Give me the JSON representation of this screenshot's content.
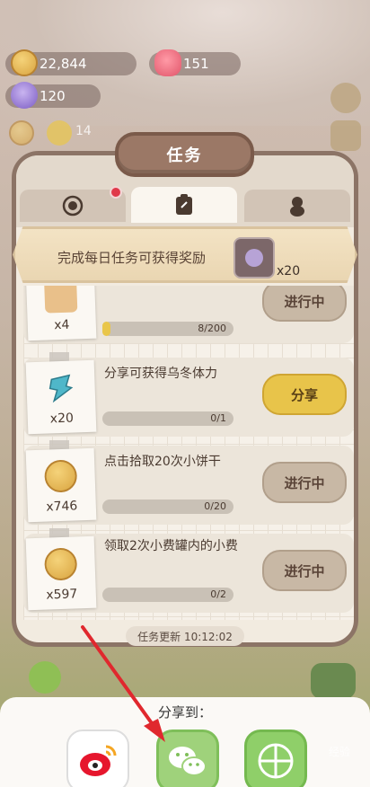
{
  "resources": [
    {
      "name": "cookie",
      "value": "22,844"
    },
    {
      "name": "pig-token",
      "value": "151"
    },
    {
      "name": "candy",
      "value": "120"
    }
  ],
  "badge_value": "14",
  "panel": {
    "title": "任务"
  },
  "tabs": [
    {
      "name": "achievement",
      "active": false,
      "has_dot": true
    },
    {
      "name": "daily",
      "active": true,
      "has_dot": false
    },
    {
      "name": "character",
      "active": false,
      "has_dot": false
    }
  ],
  "banner": {
    "text": "完成每日任务可获得奖励",
    "reward_qty": "x20"
  },
  "tasks": [
    {
      "qty": "x4",
      "text": "",
      "progress_label": "8/200",
      "progress": 0.04,
      "button": "进行中",
      "type": "progress"
    },
    {
      "qty": "x20",
      "text": "分享可获得乌冬体力",
      "progress_label": "0/1",
      "progress": 0,
      "button": "分享",
      "type": "share"
    },
    {
      "qty": "x746",
      "text": "点击拾取20次小饼干",
      "progress_label": "0/20",
      "progress": 0,
      "button": "进行中",
      "type": "progress"
    },
    {
      "qty": "x597",
      "text": "领取2次小费罐内的小费",
      "progress_label": "0/2",
      "progress": 0,
      "button": "进行中",
      "type": "progress"
    }
  ],
  "refresh": "任务更新 10:12:02",
  "share_sheet": {
    "title": "分享到：",
    "targets": [
      "weibo",
      "wechat",
      "moments"
    ]
  },
  "watermark": "经验",
  "colors": {
    "accent": "#e8c44a",
    "frame": "#8c7466",
    "wechat": "#7fbf5a"
  }
}
